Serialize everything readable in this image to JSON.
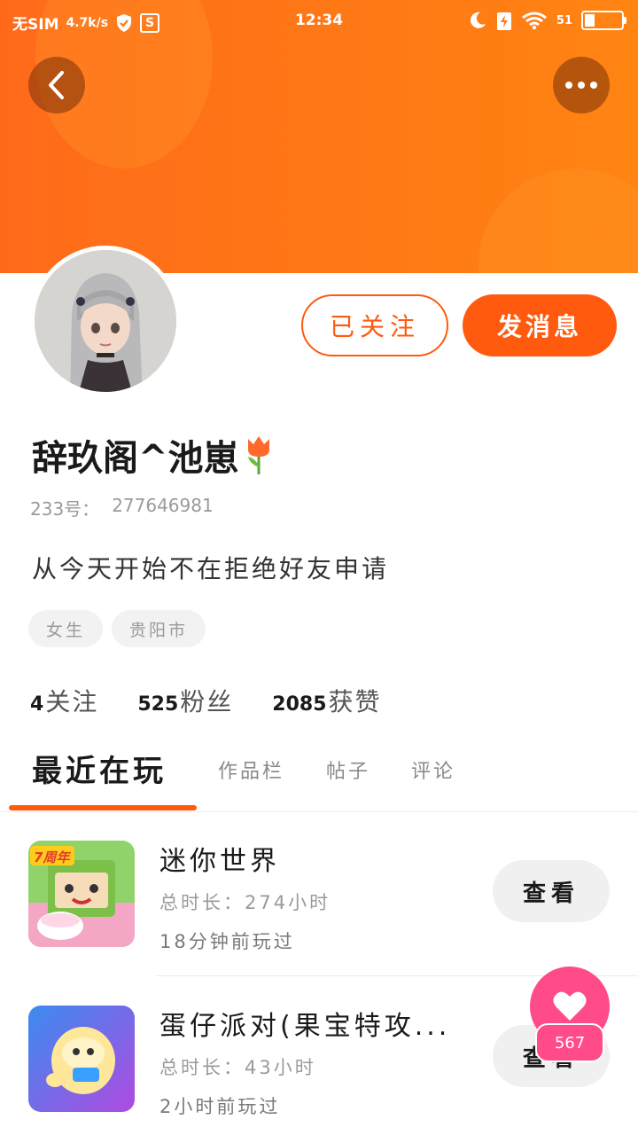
{
  "status_bar": {
    "sim": "无SIM",
    "speed": "4.7k/s",
    "time": "12:34",
    "battery_pct": "51",
    "battery_level": 0.26
  },
  "profile": {
    "name": "辞玖阁^池崽",
    "id_label": "233号：",
    "id_value": "277646981",
    "bio": "从今天开始不在拒绝好友申请",
    "tags": [
      "女生",
      "贵阳市"
    ],
    "follow_label": "已关注",
    "message_label": "发消息"
  },
  "stats": [
    {
      "value": "4",
      "label": "关注"
    },
    {
      "value": "525",
      "label": "粉丝"
    },
    {
      "value": "2085",
      "label": "获赞"
    }
  ],
  "tabs": [
    "最近在玩",
    "作品栏",
    "帖子",
    "评论"
  ],
  "games": [
    {
      "title": "迷你世界",
      "duration": "总时长：274小时",
      "last_played": "18分钟前玩过",
      "view_label": "查看",
      "badge": "7周年"
    },
    {
      "title": "蛋仔派对(果宝特攻...",
      "duration": "总时长：43小时",
      "last_played": "2小时前玩过",
      "view_label": "查看"
    }
  ],
  "like_float": {
    "count": "567"
  },
  "colors": {
    "accent": "#ff5a0e",
    "header": "#ff7a14",
    "like": "#ff4b8a"
  },
  "icons": {
    "back": "chevron-left-icon",
    "more": "more-dots-icon",
    "like": "heart-icon"
  }
}
